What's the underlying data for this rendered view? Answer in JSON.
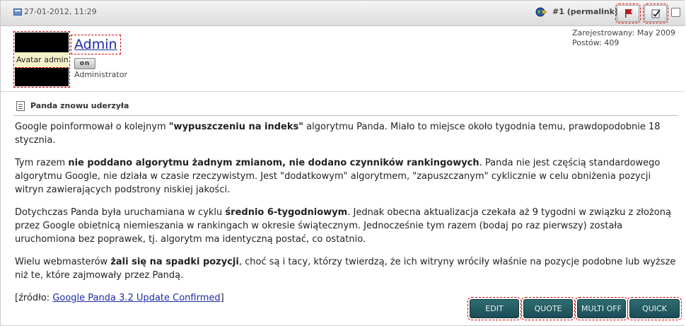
{
  "header": {
    "date": "27-01-2012, 11:29",
    "post_number": "#1",
    "permalink_label": "(permalink)"
  },
  "user": {
    "avatar_alt": "Avatar admin",
    "username": "Admin",
    "status_badge": "on",
    "title": "Administrator",
    "registered": "Zarejestrowany: May 2009",
    "posts": "Postów: 409"
  },
  "post": {
    "title": "Panda znowu uderzyła",
    "p1_a": "Google poinformował o kolejnym ",
    "p1_b": "\"wypuszczeniu na indeks\"",
    "p1_c": " algorytmu Panda. Miało to miejsce około tygodnia temu, prawdopodobnie 18 stycznia.",
    "p2_a": "Tym razem ",
    "p2_b": "nie poddano algorytmu żadnym zmianom, nie dodano czynników rankingowych",
    "p2_c": ". Panda nie jest częścią standardowego algorytmu Google, nie działa w czasie rzeczywistym. Jest \"dodatkowym\" algorytmem, \"zapuszczanym\" cyklicznie w celu obniżenia pozycji witryn zawierających podstrony niskiej jakości.",
    "p3_a": "Dotychczas Panda była uruchamiana w cyklu ",
    "p3_b": "średnio 6-tygodniowym",
    "p3_c": ". Jednak obecna aktualizacja czekała aż 9 tygodni w związku z złożoną przez Google obietnicą niemieszania w rankingach w okresie świątecznym. Jednocześnie tym razem (bodaj po raz pierwszy) została uruchomiona bez poprawek, tj. algorytm ma identyczną postać, co ostatnio.",
    "p4_a": "Wielu webmasterów ",
    "p4_b": "żali się na spadki pozycji",
    "p4_c": ", choć są i tacy, którzy twierdzą, że ich witryny wróciły właśnie na pozycje podobne lub wyższe niż te, które zajmowały przez Pandą.",
    "source_prefix": "[źródło: ",
    "source_link": "Google Panda 3.2 Update Confirmed",
    "source_suffix": "]"
  },
  "buttons": {
    "edit": "EDIT",
    "quote": "QUOTE",
    "multi": "MULTI OFF",
    "quick": "QUICK"
  },
  "colors": {
    "button_bg": "#1b4d55",
    "link": "#1e2aa8",
    "highlight_outline": "#cc0000"
  }
}
